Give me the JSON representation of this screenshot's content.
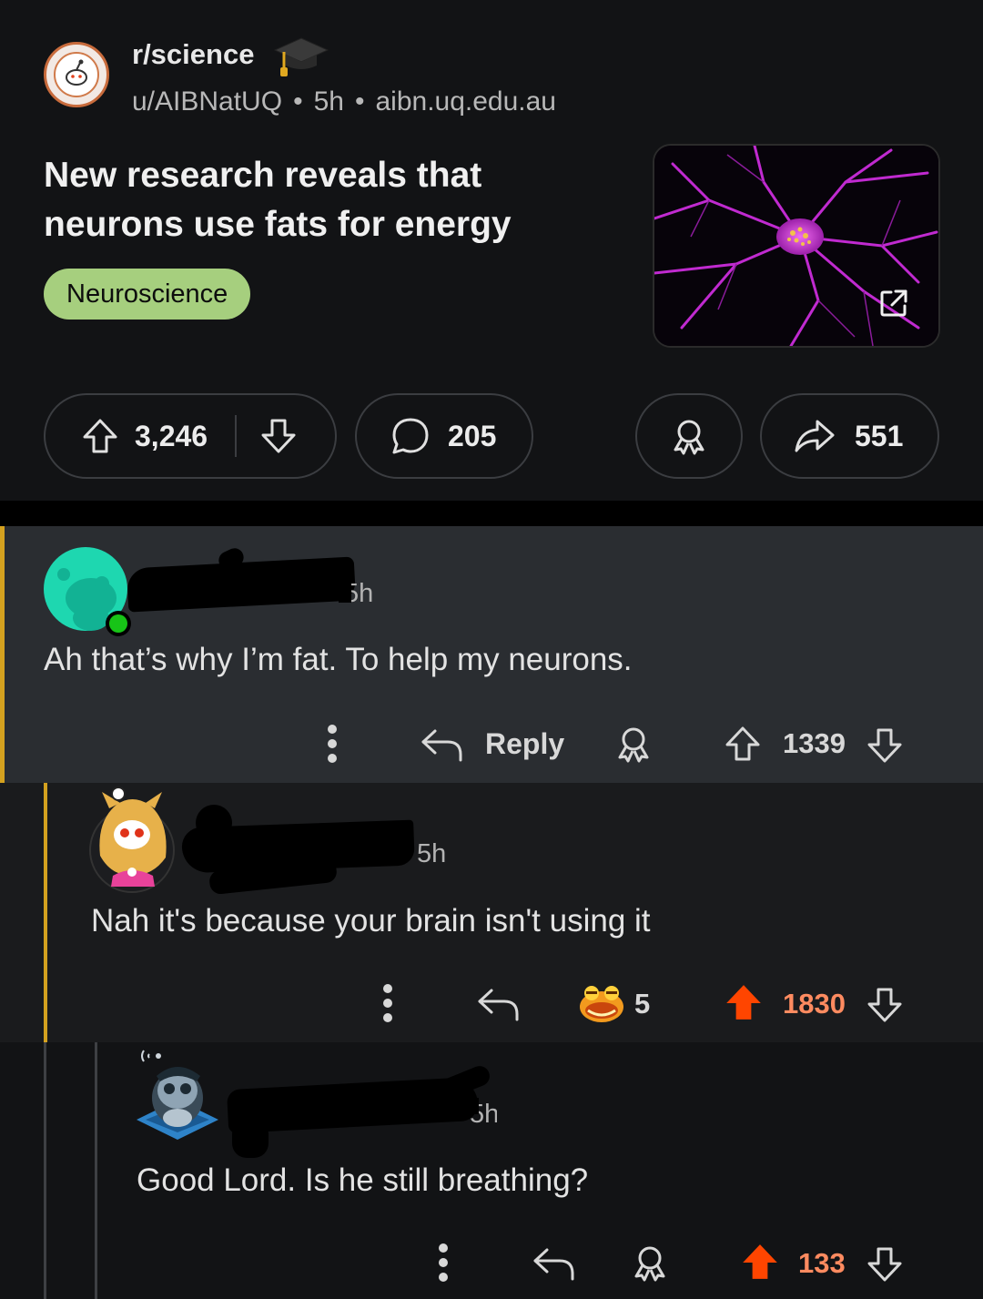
{
  "post": {
    "subreddit": "r/science",
    "author": "u/AIBNatUQ",
    "age": "5h",
    "domain": "aibn.uq.edu.au",
    "title": "New research reveals that neurons use fats for energy",
    "flair": "Neuroscience",
    "upvotes": "3,246",
    "comments": "205",
    "shares": "551"
  },
  "comments": [
    {
      "age": "5h",
      "body": "Ah that’s why I’m fat. To help my neurons.",
      "reply_label": "Reply",
      "score": "1339"
    },
    {
      "age": "5h",
      "body": "Nah it's because your brain isn't using it",
      "award_count": "5",
      "score": "1830"
    },
    {
      "age": "5h",
      "body": "Good Lord. Is he still breathing?",
      "score": "133"
    }
  ],
  "colors": {
    "upvoted": "#ff4500",
    "score_upvoted": "#ff8b60",
    "thread_line": "#d4a11f",
    "flair_bg": "#a6cf7e"
  }
}
